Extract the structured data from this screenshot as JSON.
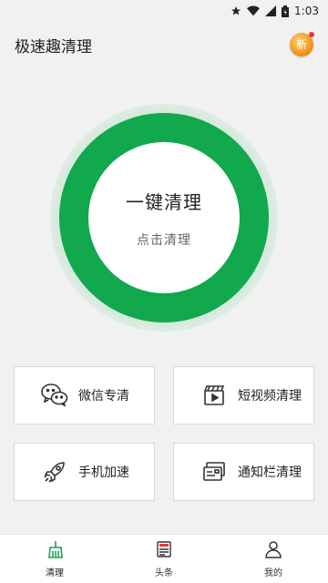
{
  "status_bar": {
    "time": "1:03"
  },
  "header": {
    "title": "极速趣清理",
    "badge_text": "新"
  },
  "clean_button": {
    "title": "一键清理",
    "subtitle": "点击清理"
  },
  "features": [
    {
      "label": "微信专清",
      "icon": "wechat-icon"
    },
    {
      "label": "短视频清理",
      "icon": "video-clapper-icon"
    },
    {
      "label": "手机加速",
      "icon": "rocket-icon"
    },
    {
      "label": "通知栏清理",
      "icon": "notification-card-icon"
    }
  ],
  "tabs": [
    {
      "label": "清理",
      "icon": "broom-icon",
      "active": true
    },
    {
      "label": "头条",
      "icon": "news-icon",
      "active": false
    },
    {
      "label": "我的",
      "icon": "user-icon",
      "active": false
    }
  ],
  "colors": {
    "accent": "#12a84e",
    "background": "#f1f1f1",
    "badge": "#f08a12"
  }
}
